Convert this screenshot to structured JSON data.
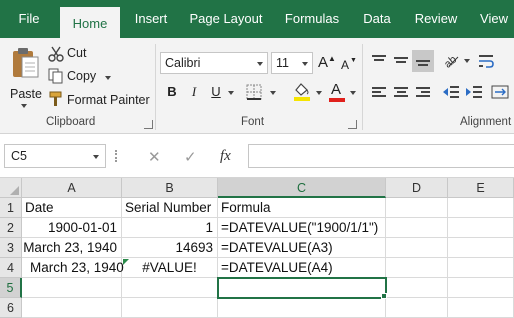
{
  "tabs": [
    {
      "label": "File"
    },
    {
      "label": "Home"
    },
    {
      "label": "Insert"
    },
    {
      "label": "Page Layout"
    },
    {
      "label": "Formulas"
    },
    {
      "label": "Data"
    },
    {
      "label": "Review"
    },
    {
      "label": "View"
    }
  ],
  "clipboard": {
    "paste_label": "Paste",
    "cut_label": "Cut",
    "copy_label": "Copy",
    "format_painter_label": "Format Painter",
    "group_label": "Clipboard"
  },
  "font": {
    "name": "Calibri",
    "size": "11",
    "bold": "B",
    "italic": "I",
    "underline": "U",
    "grow": "A",
    "shrink": "A",
    "font_color_letter": "A",
    "fill_color": "#f5e400",
    "font_color": "#e0201b",
    "group_label": "Font"
  },
  "alignment": {
    "group_label": "Alignment"
  },
  "formula_bar": {
    "name_box": "C5",
    "cancel": "✕",
    "enter": "✓",
    "fx": "fx",
    "value": ""
  },
  "columns": [
    "A",
    "B",
    "C",
    "D",
    "E"
  ],
  "rows": [
    "1",
    "2",
    "3",
    "4",
    "5",
    "6"
  ],
  "cells": {
    "A1": "Date",
    "B1": "Serial Number",
    "C1": "Formula",
    "A2": "1900-01-01",
    "B2": "1",
    "C2": "=DATEVALUE(\"1900/1/1\")",
    "A3": "March 23, 1940",
    "B3": "14693",
    "C3": "=DATEVALUE(A3)",
    "A4": "March 23, 1940",
    "B4": "#VALUE!",
    "C4": "=DATEVALUE(A4)"
  },
  "selection": {
    "active_cell": "C5"
  },
  "colors": {
    "accent": "#217346",
    "error_indicator": "#2a8a4a"
  }
}
